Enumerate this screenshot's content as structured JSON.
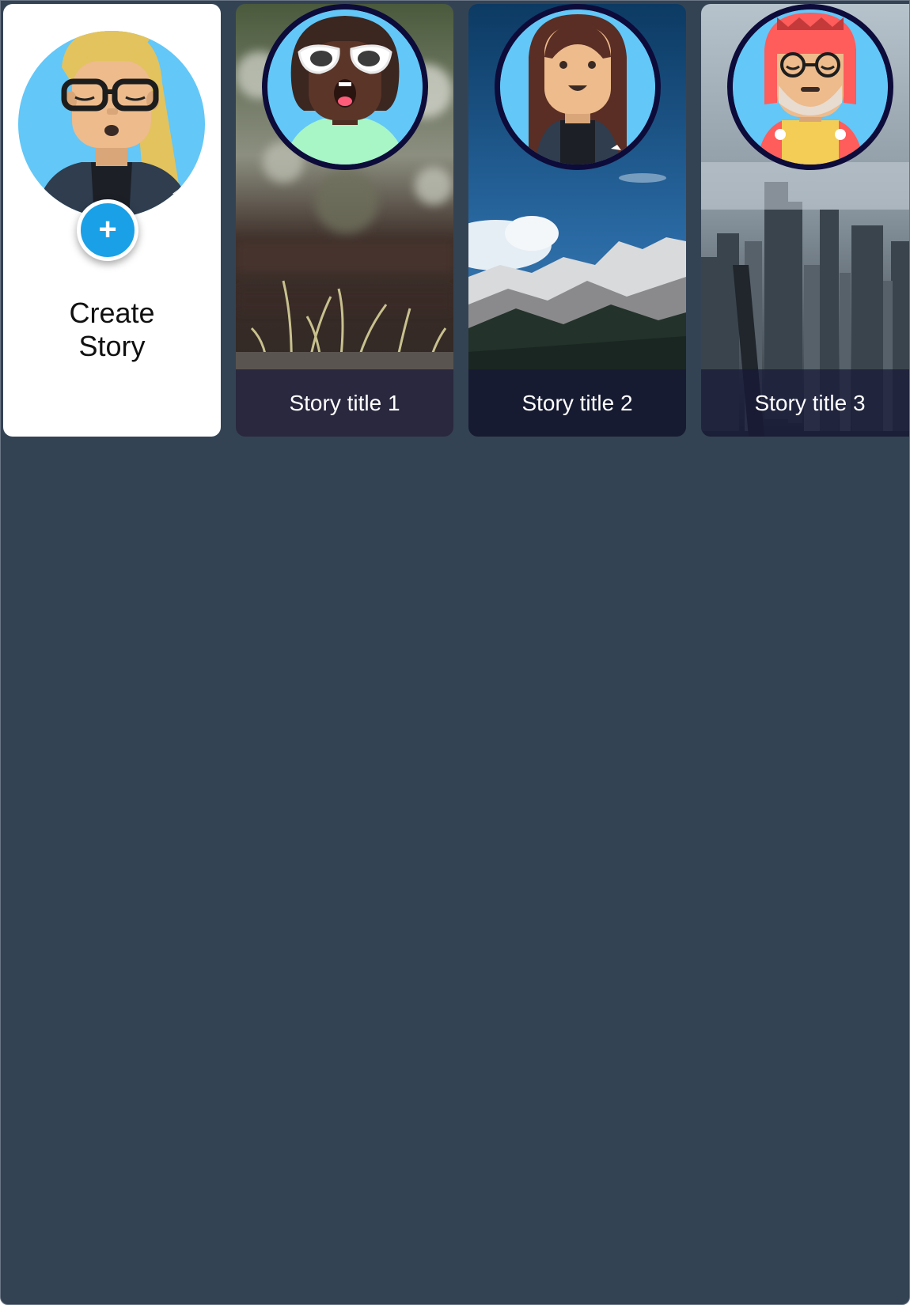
{
  "create_story": {
    "label_line1": "Create",
    "label_line2": "Story",
    "add_glyph": "+",
    "avatar_icon": "user-avatar-icon",
    "add_icon": "plus-icon",
    "accent_color": "#1aa0e6"
  },
  "stories": [
    {
      "title": "Story title 1",
      "background": "grass-photo",
      "avatar_icon": "woman-sunglasses-avatar-icon"
    },
    {
      "title": "Story title 2",
      "background": "mountain-photo",
      "avatar_icon": "woman-long-hair-avatar-icon"
    },
    {
      "title": "Story title 3",
      "background": "city-photo",
      "avatar_icon": "man-red-hat-avatar-icon"
    }
  ],
  "colors": {
    "page_background": "#344354",
    "card_background": "#ffffff",
    "avatar_ring": "#0d0b3a",
    "avatar_background": "#63c7f7"
  }
}
